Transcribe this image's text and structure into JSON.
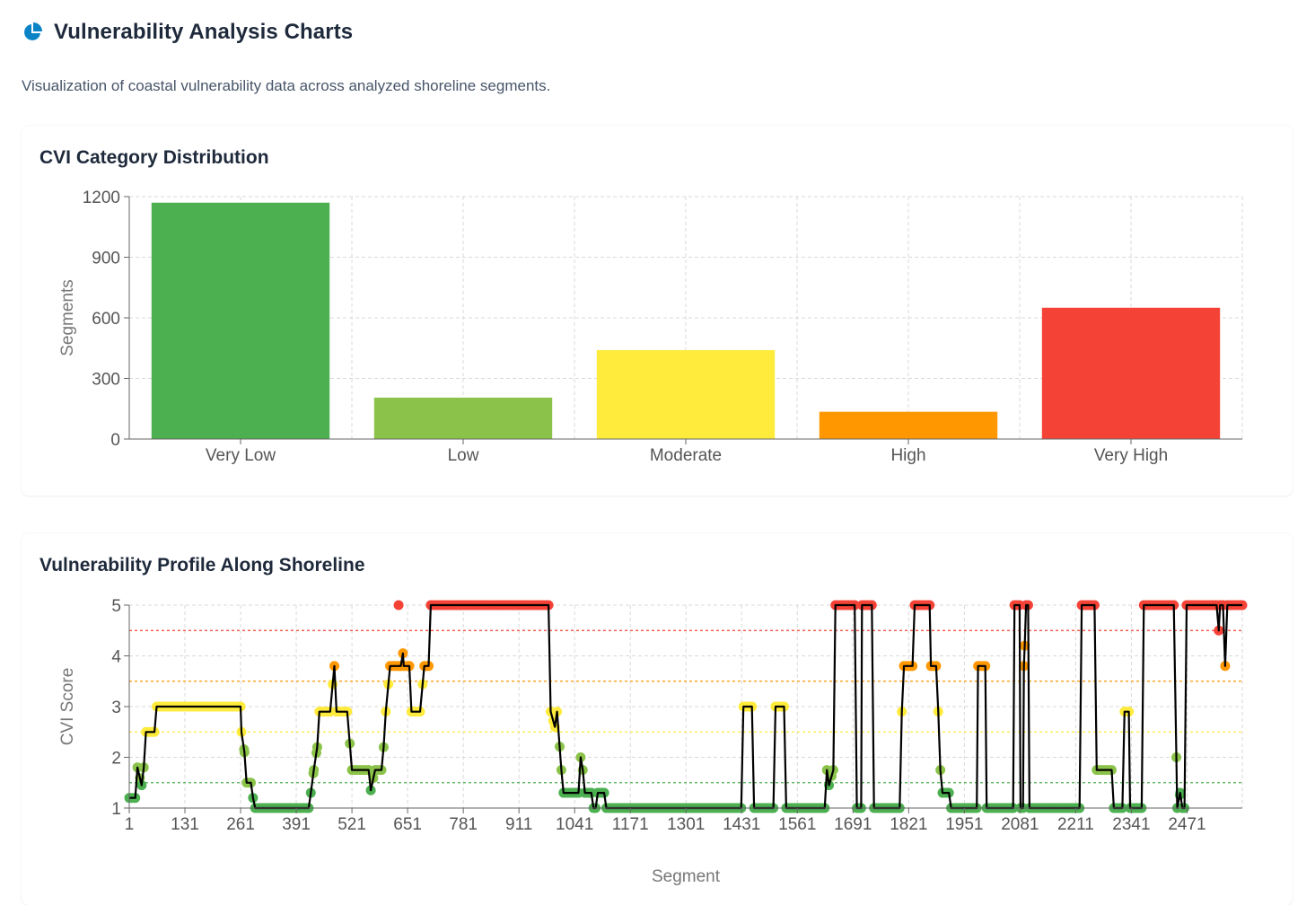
{
  "header": {
    "icon": "pie-chart-icon",
    "icon_color": "#0b84c6",
    "title": "Vulnerability Analysis Charts",
    "description": "Visualization of coastal vulnerability data across analyzed shoreline segments."
  },
  "chart_data": [
    {
      "type": "bar",
      "title": "CVI Category Distribution",
      "categories": [
        "Very Low",
        "Low",
        "Moderate",
        "High",
        "Very High"
      ],
      "values": [
        1170,
        205,
        440,
        135,
        650
      ],
      "colors": [
        "#4caf50",
        "#8bc34a",
        "#ffeb3b",
        "#ff9800",
        "#f44336"
      ],
      "xlabel": "",
      "ylabel": "Segments",
      "ylim": [
        0,
        1200
      ],
      "yticks": [
        "0",
        "300",
        "600",
        "900",
        "1200"
      ],
      "grid": true
    },
    {
      "type": "line",
      "title": "Vulnerability Profile Along Shoreline",
      "xlabel": "Segment",
      "ylabel": "CVI Score",
      "xlim": [
        1,
        2600
      ],
      "ylim": [
        1,
        5
      ],
      "xticks": [
        "1",
        "131",
        "261",
        "391",
        "521",
        "651",
        "781",
        "911",
        "1041",
        "1171",
        "1301",
        "1431",
        "1561",
        "1691",
        "1821",
        "1951",
        "2081",
        "2211",
        "2341",
        "2471"
      ],
      "yticks": [
        "1",
        "2",
        "3",
        "4",
        "5"
      ],
      "thresholds": [
        {
          "value": 1.5,
          "color": "#4caf50"
        },
        {
          "value": 2.5,
          "color": "#ffeb3b"
        },
        {
          "value": 3.5,
          "color": "#ff9800"
        },
        {
          "value": 4.5,
          "color": "#f44336"
        }
      ],
      "category_colors": {
        "very_low": "#4caf50",
        "low": "#8bc34a",
        "moderate": "#ffeb3b",
        "high": "#ff9800",
        "very_high": "#f44336"
      },
      "line_color": "#000000",
      "series": [
        {
          "points": [
            [
              1,
              1.2
            ],
            [
              15,
              1.2
            ],
            [
              20,
              1.8
            ],
            [
              30,
              1.45
            ],
            [
              35,
              1.8
            ],
            [
              40,
              2.5
            ],
            [
              50,
              2.5
            ],
            [
              60,
              2.5
            ],
            [
              65,
              3
            ],
            [
              80,
              3
            ],
            [
              261,
              3
            ],
            [
              263,
              2.5
            ],
            [
              270,
              2.1
            ],
            [
              275,
              1.5
            ],
            [
              285,
              1.5
            ],
            [
              290,
              1.2
            ],
            [
              295,
              1
            ],
            [
              420,
              1
            ],
            [
              425,
              1.3
            ],
            [
              432,
              1.75
            ],
            [
              440,
              2.2
            ],
            [
              445,
              2.9
            ],
            [
              470,
              2.9
            ],
            [
              480,
              3.8
            ],
            [
              485,
              2.9
            ],
            [
              510,
              2.9
            ],
            [
              521,
              1.75
            ],
            [
              560,
              1.75
            ],
            [
              565,
              1.35
            ],
            [
              575,
              1.75
            ],
            [
              590,
              1.75
            ],
            [
              595,
              2.2
            ],
            [
              600,
              2.9
            ],
            [
              610,
              3.8
            ],
            [
              635,
              3.8
            ],
            [
              640,
              4.05
            ],
            [
              642,
              3.8
            ],
            [
              655,
              3.8
            ],
            [
              660,
              2.9
            ],
            [
              680,
              2.9
            ],
            [
              690,
              3.8
            ],
            [
              700,
              3.8
            ],
            [
              705,
              5
            ],
            [
              980,
              5
            ],
            [
              985,
              2.9
            ],
            [
              995,
              2.6
            ],
            [
              1000,
              2.9
            ],
            [
              1010,
              1.75
            ],
            [
              1015,
              1.3
            ],
            [
              1050,
              1.3
            ],
            [
              1055,
              2
            ],
            [
              1060,
              1.75
            ],
            [
              1065,
              1.3
            ],
            [
              1080,
              1.3
            ],
            [
              1085,
              1
            ],
            [
              1090,
              1
            ],
            [
              1095,
              1.3
            ],
            [
              1110,
              1.3
            ],
            [
              1115,
              1
            ],
            [
              1430,
              1
            ],
            [
              1435,
              3
            ],
            [
              1455,
              3
            ],
            [
              1460,
              1
            ],
            [
              1505,
              1
            ],
            [
              1510,
              3
            ],
            [
              1530,
              3
            ],
            [
              1535,
              1
            ],
            [
              1625,
              1
            ],
            [
              1630,
              1.75
            ],
            [
              1635,
              1.45
            ],
            [
              1645,
              1.75
            ],
            [
              1650,
              5
            ],
            [
              1695,
              5
            ],
            [
              1700,
              1
            ],
            [
              1710,
              1
            ],
            [
              1712,
              5
            ],
            [
              1735,
              5
            ],
            [
              1740,
              1
            ],
            [
              1800,
              1
            ],
            [
              1805,
              2.9
            ],
            [
              1810,
              3.8
            ],
            [
              1830,
              3.8
            ],
            [
              1835,
              5
            ],
            [
              1870,
              5
            ],
            [
              1873,
              3.8
            ],
            [
              1885,
              3.8
            ],
            [
              1890,
              2.9
            ],
            [
              1895,
              1.75
            ],
            [
              1900,
              1.3
            ],
            [
              1915,
              1.3
            ],
            [
              1920,
              1
            ],
            [
              1980,
              1
            ],
            [
              1983,
              3.8
            ],
            [
              2000,
              3.8
            ],
            [
              2003,
              1
            ],
            [
              2065,
              1
            ],
            [
              2068,
              5
            ],
            [
              2080,
              5
            ],
            [
              2082,
              1
            ],
            [
              2088,
              1
            ],
            [
              2090,
              3.8
            ],
            [
              2092,
              4.2
            ],
            [
              2095,
              5
            ],
            [
              2100,
              5
            ],
            [
              2103,
              1
            ],
            [
              2220,
              1
            ],
            [
              2225,
              5
            ],
            [
              2255,
              5
            ],
            [
              2260,
              1.75
            ],
            [
              2295,
              1.75
            ],
            [
              2300,
              1
            ],
            [
              2320,
              1
            ],
            [
              2325,
              2.9
            ],
            [
              2335,
              2.9
            ],
            [
              2338,
              1
            ],
            [
              2365,
              1
            ],
            [
              2370,
              5
            ],
            [
              2440,
              5
            ],
            [
              2448,
              1
            ],
            [
              2455,
              1.3
            ],
            [
              2460,
              1
            ],
            [
              2465,
              1
            ],
            [
              2470,
              5
            ],
            [
              2540,
              5
            ],
            [
              2545,
              4.5
            ],
            [
              2548,
              5
            ],
            [
              2555,
              5
            ],
            [
              2560,
              3.8
            ],
            [
              2565,
              5
            ],
            [
              2600,
              5
            ]
          ]
        }
      ]
    }
  ]
}
